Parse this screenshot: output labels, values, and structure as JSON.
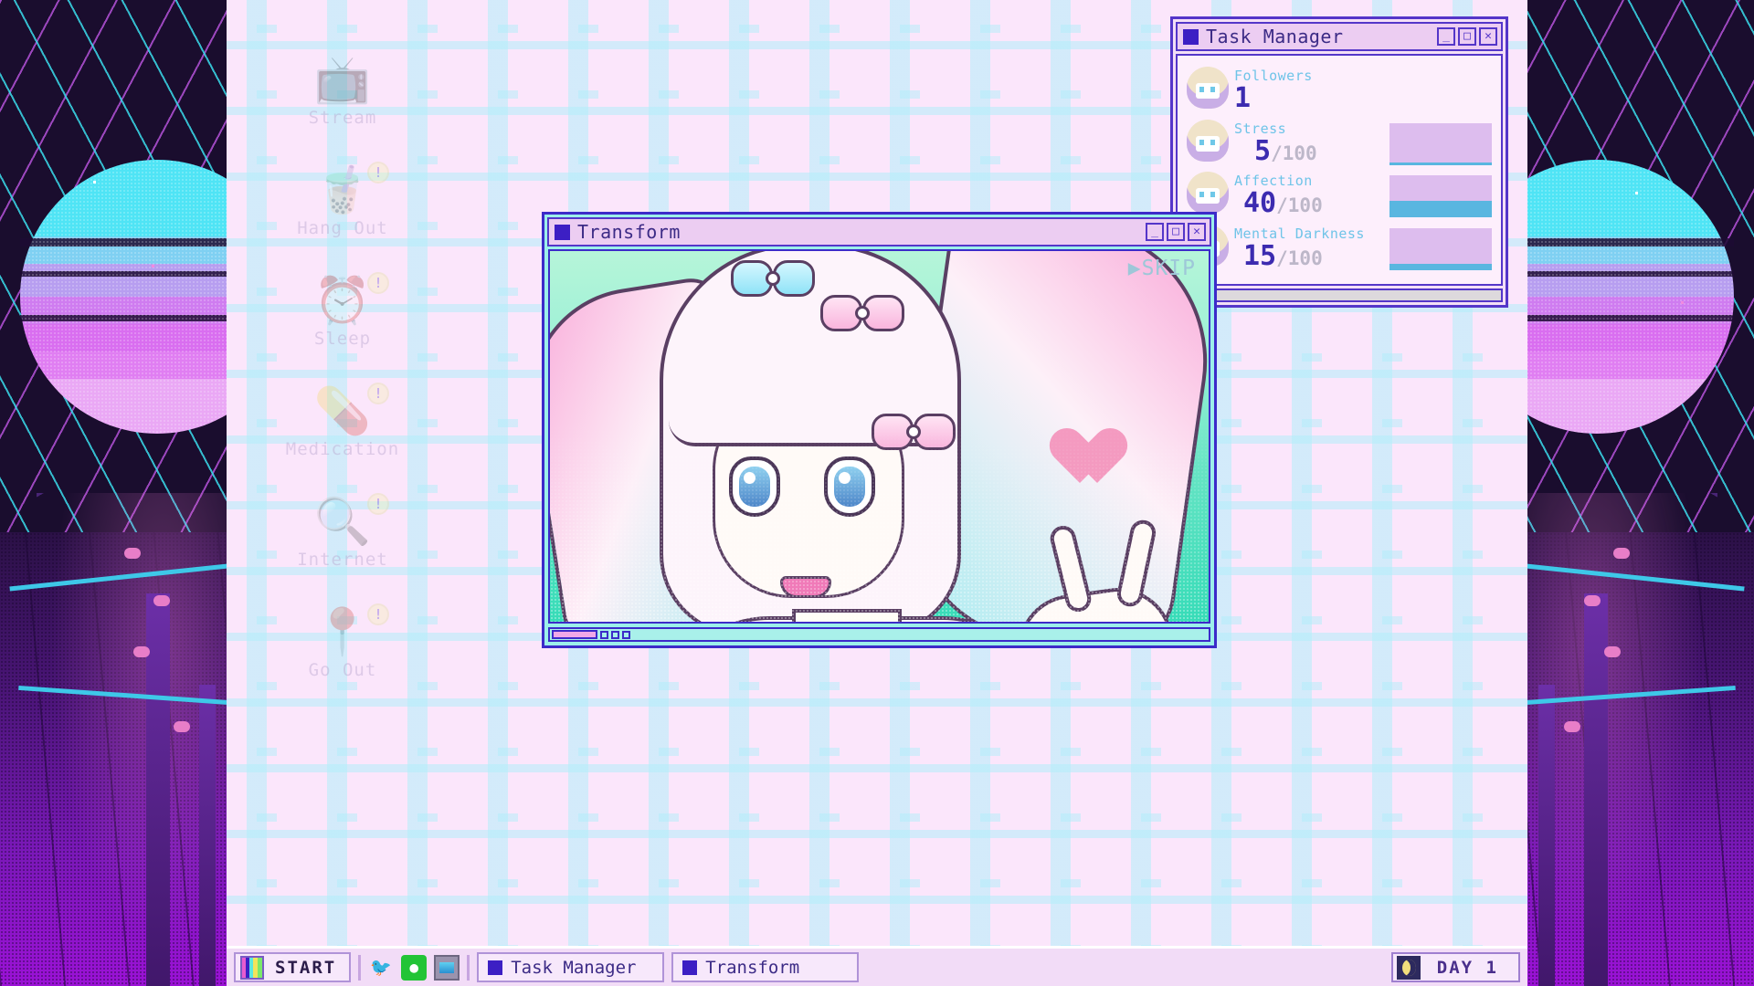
{
  "desktop_icons": [
    {
      "label": "Stream",
      "icon": "stream-icon",
      "glyph": "📺",
      "badge": "!",
      "badge_visible": false
    },
    {
      "label": "Hang Out",
      "icon": "hang-out-icon",
      "glyph": "🧋",
      "badge": "!",
      "badge_visible": true
    },
    {
      "label": "Sleep",
      "icon": "sleep-icon",
      "glyph": "⏰",
      "badge": "!",
      "badge_visible": true
    },
    {
      "label": "Medication",
      "icon": "medication-icon",
      "glyph": "💊",
      "badge": "!",
      "badge_visible": true
    },
    {
      "label": "Internet",
      "icon": "internet-icon",
      "glyph": "🔍",
      "badge": "!",
      "badge_visible": true
    },
    {
      "label": "Go Out",
      "icon": "go-out-icon",
      "glyph": "📍",
      "badge": "!",
      "badge_visible": true
    }
  ],
  "task_manager": {
    "title": "Task Manager",
    "buttons": {
      "minimize": "_",
      "maximize": "□",
      "close": "✕"
    },
    "stats": [
      {
        "label": "Followers",
        "value": "1",
        "max": "",
        "separator": "",
        "has_bar": false,
        "percent": 0,
        "icon": "follower-girl-icon"
      },
      {
        "label": "Stress",
        "value": "5",
        "max": "100",
        "separator": "/",
        "has_bar": true,
        "percent": 5,
        "icon": "stress-girl-icon"
      },
      {
        "label": "Affection",
        "value": "40",
        "max": "100",
        "separator": "/",
        "has_bar": true,
        "percent": 40,
        "icon": "affection-girl-icon"
      },
      {
        "label": "Mental Darkness",
        "value": "15",
        "max": "100",
        "separator": "/",
        "has_bar": true,
        "percent": 15,
        "icon": "darkness-girl-icon"
      }
    ],
    "bar_track_color": "#ddbdee",
    "bar_fill_color": "#59b6e0",
    "label_color": "#6fc4e8",
    "value_color": "#3c2bb0"
  },
  "transform_window": {
    "title": "Transform",
    "buttons": {
      "minimize": "_",
      "maximize": "□",
      "close": "✕"
    },
    "skip_label": "▶SKIP",
    "artwork": "magical-girl-peace-sign-portrait",
    "bg_color": "#62e3c3"
  },
  "taskbar": {
    "start_label": "START",
    "start_icon": "windows-start-icon",
    "tray": [
      {
        "name": "twitter-bird-icon",
        "glyph": "🐦"
      },
      {
        "name": "chat-bubble-icon",
        "glyph": "💬"
      },
      {
        "name": "monitor-icon",
        "glyph": "🖥"
      }
    ],
    "windows": [
      {
        "label": "Task Manager",
        "name": "taskbar-item-task-manager"
      },
      {
        "label": "Transform",
        "name": "taskbar-item-transform"
      }
    ],
    "day_label": "DAY 1",
    "day_icon": "crescent-moon-icon"
  },
  "colors": {
    "window_border": "#5436c9",
    "title_bg": "#eccdf2",
    "title_text": "#3c2b86",
    "desktop_bg": "#fbe6fb",
    "taskbar_bg": "#f2dcf7",
    "accent_blue": "#59b6e0",
    "accent_purple": "#3c1fc4"
  }
}
